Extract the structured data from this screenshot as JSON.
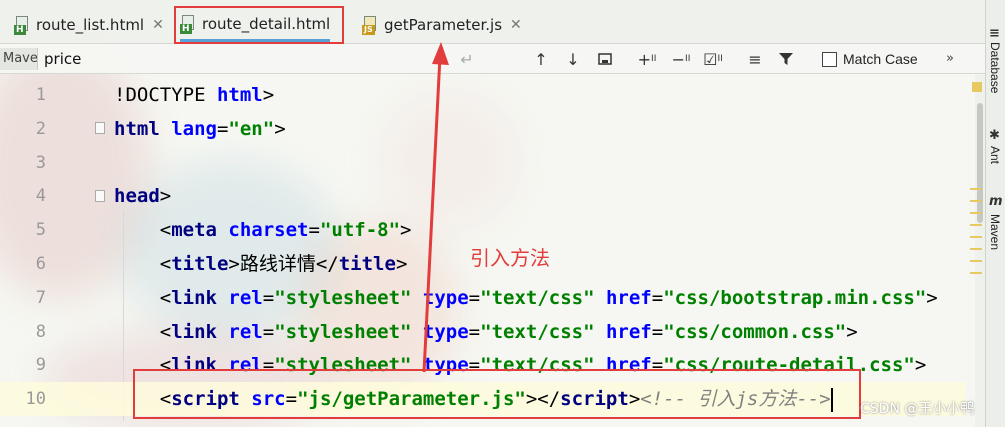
{
  "tabs": [
    {
      "label": "route_list.html",
      "badge": "H",
      "active": false
    },
    {
      "label": "route_detail.html",
      "badge": "H",
      "active": true
    },
    {
      "label": "getParameter.js",
      "badge": "JS",
      "active": false
    }
  ],
  "search": {
    "side_tab": "Maven",
    "value": "price",
    "match_case_label": "Match Case",
    "more_label": "»"
  },
  "right_strip": {
    "database_label": "Database",
    "ant_label": "Ant",
    "maven_label": "Maven"
  },
  "code_lines": [
    {
      "n": "1",
      "tokens": [
        {
          "t": "!DOCTYPE ",
          "c": "plain"
        },
        {
          "t": "html",
          "c": "attr"
        },
        {
          "t": ">",
          "c": "plain"
        }
      ]
    },
    {
      "n": "2",
      "tokens": [
        {
          "t": "html ",
          "c": "tag"
        },
        {
          "t": "lang",
          "c": "attr"
        },
        {
          "t": "=",
          "c": "plain"
        },
        {
          "t": "\"en\"",
          "c": "val"
        },
        {
          "t": ">",
          "c": "plain"
        }
      ]
    },
    {
      "n": "3",
      "tokens": []
    },
    {
      "n": "4",
      "tokens": [
        {
          "t": "head",
          "c": "tag"
        },
        {
          "t": ">",
          "c": "plain"
        }
      ]
    },
    {
      "n": "5",
      "tokens": [
        {
          "t": "    <",
          "c": "plain"
        },
        {
          "t": "meta ",
          "c": "tag"
        },
        {
          "t": "charset",
          "c": "attr"
        },
        {
          "t": "=",
          "c": "plain"
        },
        {
          "t": "\"utf-8\"",
          "c": "val"
        },
        {
          "t": ">",
          "c": "plain"
        }
      ]
    },
    {
      "n": "6",
      "tokens": [
        {
          "t": "    <",
          "c": "plain"
        },
        {
          "t": "title",
          "c": "tag"
        },
        {
          "t": ">路线详情</",
          "c": "plain"
        },
        {
          "t": "title",
          "c": "tag"
        },
        {
          "t": ">",
          "c": "plain"
        }
      ]
    },
    {
      "n": "7",
      "tokens": [
        {
          "t": "    <",
          "c": "plain"
        },
        {
          "t": "link ",
          "c": "tag"
        },
        {
          "t": "rel",
          "c": "attr"
        },
        {
          "t": "=",
          "c": "plain"
        },
        {
          "t": "\"stylesheet\" ",
          "c": "val"
        },
        {
          "t": "type",
          "c": "attr"
        },
        {
          "t": "=",
          "c": "plain"
        },
        {
          "t": "\"text/css\" ",
          "c": "val"
        },
        {
          "t": "href",
          "c": "attr"
        },
        {
          "t": "=",
          "c": "plain"
        },
        {
          "t": "\"css/bootstrap.min.css\"",
          "c": "val"
        },
        {
          "t": ">",
          "c": "plain"
        }
      ]
    },
    {
      "n": "8",
      "tokens": [
        {
          "t": "    <",
          "c": "plain"
        },
        {
          "t": "link ",
          "c": "tag"
        },
        {
          "t": "rel",
          "c": "attr"
        },
        {
          "t": "=",
          "c": "plain"
        },
        {
          "t": "\"stylesheet\" ",
          "c": "val"
        },
        {
          "t": "type",
          "c": "attr"
        },
        {
          "t": "=",
          "c": "plain"
        },
        {
          "t": "\"text/css\" ",
          "c": "val"
        },
        {
          "t": "href",
          "c": "attr"
        },
        {
          "t": "=",
          "c": "plain"
        },
        {
          "t": "\"css/common.css\"",
          "c": "val"
        },
        {
          "t": ">",
          "c": "plain"
        }
      ]
    },
    {
      "n": "9",
      "tokens": [
        {
          "t": "    <",
          "c": "plain"
        },
        {
          "t": "link ",
          "c": "tag"
        },
        {
          "t": "rel",
          "c": "attr"
        },
        {
          "t": "=",
          "c": "plain"
        },
        {
          "t": "\"stylesheet\" ",
          "c": "val"
        },
        {
          "t": "type",
          "c": "attr"
        },
        {
          "t": "=",
          "c": "plain"
        },
        {
          "t": "\"text/css\" ",
          "c": "val"
        },
        {
          "t": "href",
          "c": "attr"
        },
        {
          "t": "=",
          "c": "plain"
        },
        {
          "t": "\"css/route-detail.css\"",
          "c": "val"
        },
        {
          "t": ">",
          "c": "plain"
        }
      ]
    },
    {
      "n": "10",
      "tokens": [
        {
          "t": "    <",
          "c": "plain"
        },
        {
          "t": "script ",
          "c": "tag"
        },
        {
          "t": "src",
          "c": "attr"
        },
        {
          "t": "=",
          "c": "plain"
        },
        {
          "t": "\"js/getParameter.js\"",
          "c": "val"
        },
        {
          "t": "></",
          "c": "plain"
        },
        {
          "t": "script",
          "c": "tag"
        },
        {
          "t": ">",
          "c": "plain"
        },
        {
          "t": "<!-- 引入js方法-->",
          "c": "cmt"
        }
      ]
    }
  ],
  "annotation": "引入方法",
  "watermark": "CSDN @王小小鸭",
  "colors": {
    "highlight_red": "#e23c3c",
    "tag": "#000080",
    "attribute": "#0000ff",
    "string": "#008000",
    "comment": "#808080"
  }
}
